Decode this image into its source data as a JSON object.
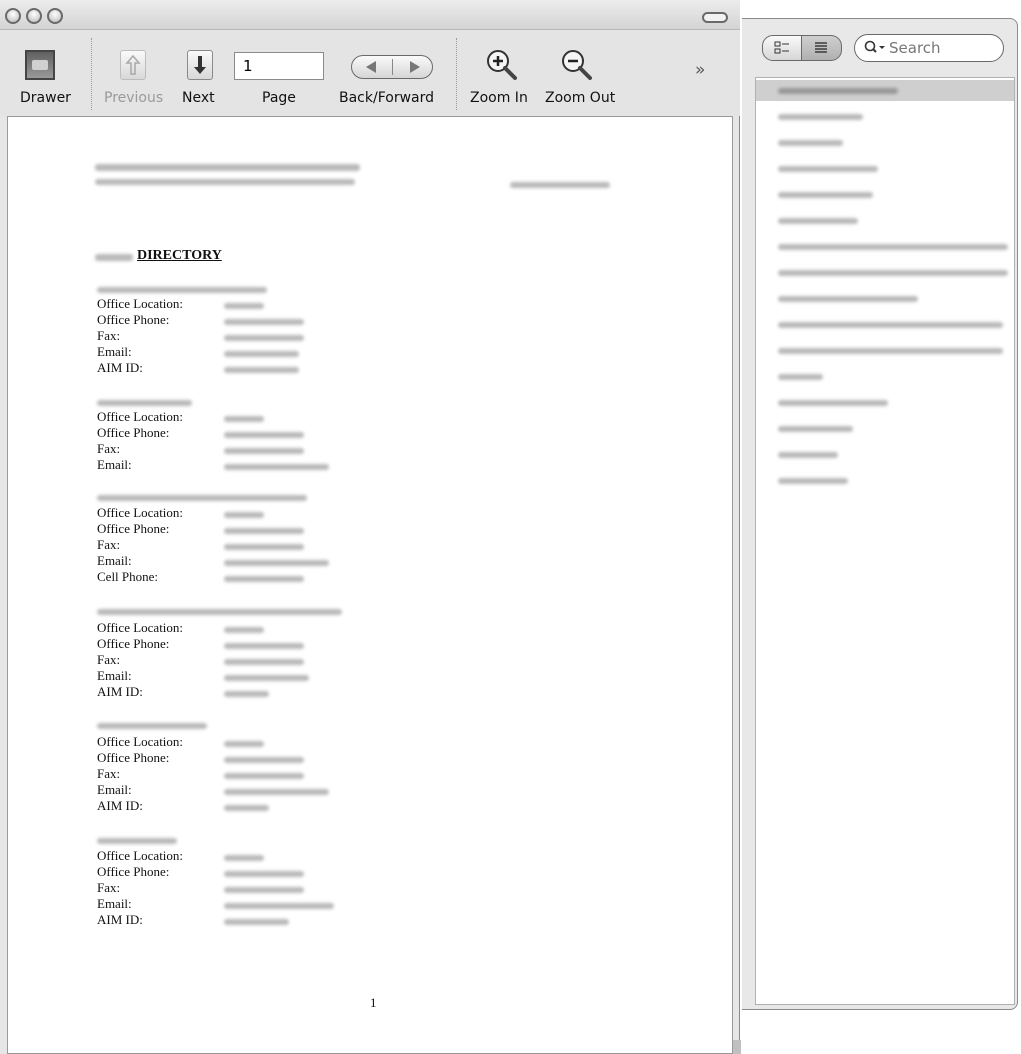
{
  "toolbar": {
    "drawer_label": "Drawer",
    "previous_label": "Previous",
    "next_label": "Next",
    "page_label": "Page",
    "page_value": "1",
    "back_forward_label": "Back/Forward",
    "zoom_in_label": "Zoom In",
    "zoom_out_label": "Zoom Out",
    "overflow_icon": "double-chevron-right-icon"
  },
  "sidebar": {
    "search_placeholder": "Search",
    "view_modes": [
      "thumbnail-view-icon",
      "outline-view-icon"
    ]
  },
  "document": {
    "heading": "DIRECTORY",
    "page_number": "1",
    "entries": [
      {
        "fields": [
          "Office Location:",
          "Office Phone:",
          "Fax:",
          "Email:",
          "AIM ID:"
        ]
      },
      {
        "fields": [
          "Office Location:",
          "Office Phone:",
          "Fax:",
          "Email:"
        ]
      },
      {
        "fields": [
          "Office Location:",
          "Office Phone:",
          "Fax:",
          "Email:",
          "Cell Phone:"
        ]
      },
      {
        "fields": [
          "Office Location:",
          "Office Phone:",
          "Fax:",
          "Email:",
          "AIM ID:"
        ]
      },
      {
        "fields": [
          "Office Location:",
          "Office Phone:",
          "Fax:",
          "Email:",
          "AIM ID:"
        ]
      },
      {
        "fields": [
          "Office Location:",
          "Office Phone:",
          "Fax:",
          "Email:",
          "AIM ID:"
        ]
      }
    ]
  }
}
